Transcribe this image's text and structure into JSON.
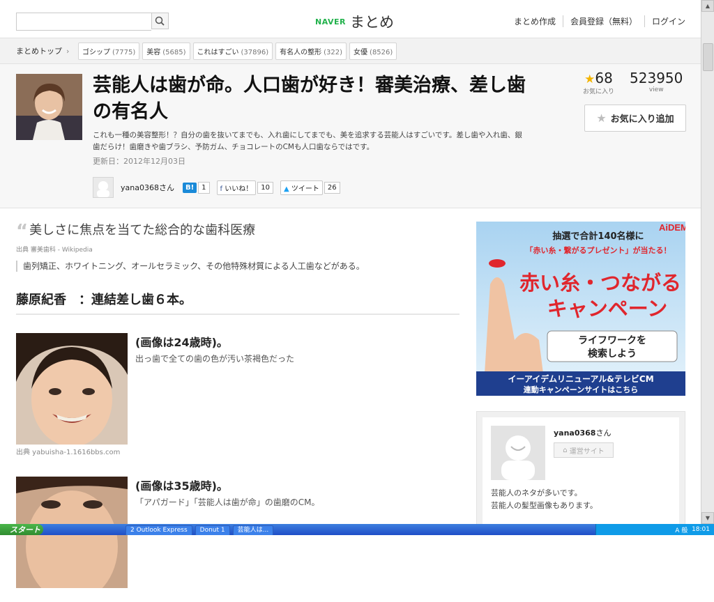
{
  "topbar": {
    "search_placeholder": "",
    "logo_naver": "NAVER",
    "logo_matome": "まとめ",
    "links": [
      "まとめ作成",
      "会員登録（無料）",
      "ログイン"
    ]
  },
  "catbar": {
    "breadcrumb": "まとめトップ",
    "categories": [
      {
        "label": "ゴシップ",
        "count": "(7775)"
      },
      {
        "label": "美容",
        "count": "(5685)"
      },
      {
        "label": "これはすごい",
        "count": "(37896)"
      },
      {
        "label": "有名人の整形",
        "count": "(322)"
      },
      {
        "label": "女優",
        "count": "(8526)"
      }
    ]
  },
  "article": {
    "title": "芸能人は歯が命。人口歯が好き！審美治療、差し歯の有名人",
    "description": "これも一種の美容整形！？自分の歯を抜いてまでも、入れ歯にしてまでも、美を追求する芸能人はすごいです。差し歯や入れ歯、銀歯だらけ！歯磨きや歯ブラシ、予防ガム、チョコレートのCMも人口歯ならではです。",
    "updated": "更新日：2012年12月03日",
    "author": "yana0368さん",
    "hatena_count": "1",
    "like_label": "いいね！",
    "like_count": "10",
    "tweet_label": "ツイート",
    "tweet_count": "26"
  },
  "stats": {
    "fav_count": "68",
    "fav_label": "お気に入り",
    "view_count": "523950",
    "view_label": "view",
    "add_fav_label": "お気に入り追加"
  },
  "main": {
    "quote_title": "美しさに焦点を当てた総合的な歯科医療",
    "quote_source": "出典  審美歯科 - Wikipedia",
    "quote_body": "歯列矯正、ホワイトニング、オールセラミック、その他特殊材質による人工歯などがある。",
    "heading": "藤原紀香　：連結差し歯６本。",
    "items": [
      {
        "caption": "(画像は24歳時)。",
        "note": "出っ歯で全ての歯の色が汚い茶褐色だった",
        "source": "出典  yabuisha-1.1616bbs.com"
      },
      {
        "caption": "(画像は35歳時)。",
        "note": "「アパガード」「芸能人は歯が命」の歯磨のCM。",
        "source": ""
      }
    ]
  },
  "ad": {
    "brand": "AiDEM",
    "line1": "抽選で合計140名様に",
    "line2": "「赤い糸・繋がるプレゼント」が当たる！",
    "headline1": "赤い糸・つながる",
    "headline2": "キャンペーン",
    "cta1": "ライフワークを",
    "cta2": "検索しよう",
    "footer1": "イーアイデムリニューアル&テレビCM",
    "footer2": "連動キャンペーンサイトはこちら"
  },
  "profile": {
    "name": "yana0368",
    "san": "さん",
    "button": "運営サイト",
    "desc1": "芸能人のネタが多いです。",
    "desc2": "芸能人の髪型画像もあります。"
  },
  "taskbar": {
    "start": "スタート",
    "tasks": [
      "2 Outlook Express",
      "Donut 1",
      "芸能人は..."
    ],
    "tray_text": "A 般",
    "clock": "18:01"
  },
  "colors": {
    "naver_green": "#22b24c",
    "hatena_blue": "#1a8ad8",
    "ad_red": "#e0262d",
    "taskbar": "#245edb"
  }
}
